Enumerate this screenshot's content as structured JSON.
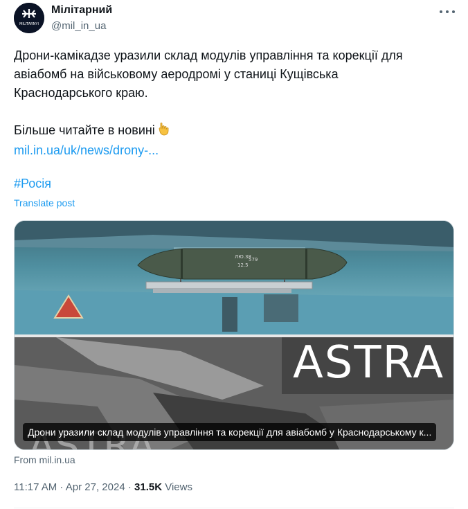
{
  "author": {
    "name": "Мілітарний",
    "handle": "@mil_in_ua",
    "avatar_label": "MILITARNYI",
    "avatar_icon": "militarnyi-logo-icon"
  },
  "post": {
    "line1": "Дрони-камікадзе уразили склад модулів управління та корекції для",
    "line2": "авіабомб на військовому аеродромі у станиці Кущівська",
    "line3": "Краснодарського краю.",
    "line4": "Більше читайте в новині",
    "point_icon": "pointing-down-hand-icon",
    "link": "mil.in.ua/uk/news/drony-...",
    "hashtag": "#Росія",
    "translate": "Translate post"
  },
  "card": {
    "top_image": "aircraft-bomb-photo",
    "bomb_markings": [
      "ЛЮ.38",
      "579",
      "12.5"
    ],
    "watermark": "ASTRA",
    "watermark_lower": "ASTRA",
    "caption": "Дрони уразили склад модулів управління та корекції для авіабомб у Краснодарському к..."
  },
  "source": "From mil.in.ua",
  "meta": {
    "time": "11:17 AM",
    "sep": " · ",
    "date": "Apr 27, 2024",
    "views_count": "31.5K",
    "views_label": "Views"
  },
  "colors": {
    "link": "#1d9bf0",
    "secondary": "#536471",
    "text": "#0f1419",
    "border": "#cfd9de"
  }
}
